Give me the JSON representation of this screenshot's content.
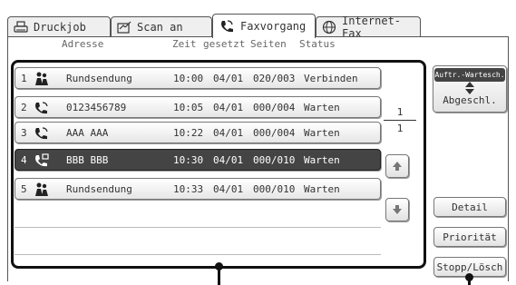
{
  "tabs": [
    {
      "label": "Druckjob",
      "icon": "printer-icon"
    },
    {
      "label": "Scan an",
      "icon": "scan-icon"
    },
    {
      "label": "Faxvorgang",
      "icon": "fax-phone-icon"
    },
    {
      "label": "Internet-Fax",
      "icon": "internet-fax-icon"
    }
  ],
  "columns": {
    "address": "Adresse",
    "time": "Zeit",
    "set": "gesetzt",
    "pages": "Seiten",
    "status": "Status"
  },
  "jobs": [
    {
      "num": "1",
      "icon": "broadcast-icon",
      "address": "Rundsendung",
      "time": "10:00",
      "date": "04/01",
      "pages": "020/003",
      "status": "Verbinden",
      "selected": false
    },
    {
      "num": "2",
      "icon": "fax-phone-icon",
      "address": "0123456789",
      "time": "10:05",
      "date": "04/01",
      "pages": "000/004",
      "status": "Warten",
      "selected": false
    },
    {
      "num": "3",
      "icon": "fax-phone-icon",
      "address": "AAA AAA",
      "time": "10:22",
      "date": "04/01",
      "pages": "000/004",
      "status": "Warten",
      "selected": false
    },
    {
      "num": "4",
      "icon": "fax-phone-icon",
      "address": "BBB BBB",
      "time": "10:30",
      "date": "04/01",
      "pages": "000/010",
      "status": "Warten",
      "selected": true
    },
    {
      "num": "5",
      "icon": "broadcast-icon",
      "address": "Rundsendung",
      "time": "10:33",
      "date": "04/01",
      "pages": "000/010",
      "status": "Warten",
      "selected": false
    }
  ],
  "pager": {
    "current": "1",
    "total": "1"
  },
  "buttons": {
    "queue_top": "Auftr.-Wartesch.",
    "queue_bottom": "Abgeschl.",
    "detail": "Detail",
    "priority": "Priorität",
    "stop_delete": "Stopp/Lösch"
  }
}
